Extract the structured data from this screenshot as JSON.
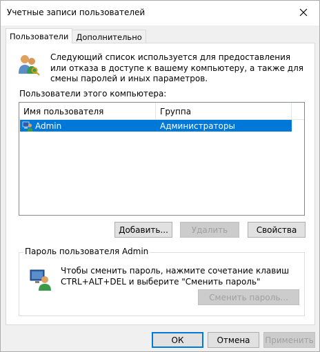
{
  "window": {
    "title": "Учетные записи пользователей",
    "close_glyph": "✕"
  },
  "tabs": [
    {
      "label": "Пользователи",
      "active": true
    },
    {
      "label": "Дополнительно",
      "active": false
    }
  ],
  "intro": {
    "text": "Следующий список используется для предоставления или отказа в доступе к вашему компьютеру, а также для смены паролей и иных параметров.",
    "icon": "users-keys-icon"
  },
  "users_list": {
    "label": "Пользователи этого компьютера:",
    "columns": [
      "Имя пользователя",
      "Группа"
    ],
    "rows": [
      {
        "name": "Admin",
        "group": "Администраторы",
        "selected": true,
        "icon": "user-icon"
      }
    ]
  },
  "list_buttons": {
    "add": "Добавить...",
    "remove": "Удалить",
    "properties": "Свойства"
  },
  "password_group": {
    "legend": "Пароль пользователя Admin",
    "text": "Чтобы сменить пароль, нажмите сочетание клавиш CTRL+ALT+DEL и выберите \"Сменить пароль\"",
    "change_button": "Сменить пароль...",
    "icon": "user-computer-icon"
  },
  "dialog_buttons": {
    "ok": "ОК",
    "cancel": "Отмена",
    "apply": "Применить"
  },
  "colors": {
    "selection": "#0078d7",
    "panel_bg": "#ffffff",
    "window_bg": "#f0f0f0"
  }
}
